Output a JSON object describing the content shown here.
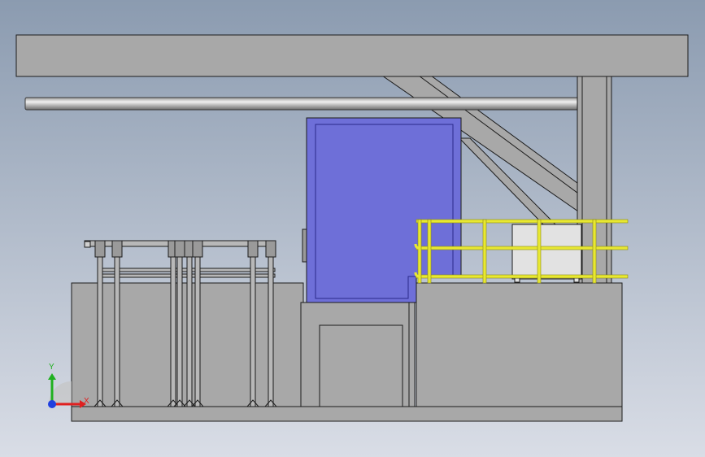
{
  "viewport": {
    "background_top": "#8b9bb0",
    "background_bottom": "#d9dde6"
  },
  "colors": {
    "structure_gray": "#a8a8a8",
    "structure_dark": "#9a9a9a",
    "outline": "#1c1c1c",
    "panel_blue": "#6e6fd8",
    "panel_blue_edge": "#3434a8",
    "rail_yellow": "#e8e832",
    "rail_yellow_edge": "#8a8a10",
    "cabinet_white": "#e2e2e2",
    "pipe_light": "#dcdcdc",
    "pipe_dark": "#7c7c7c",
    "rack_frame": "#b8b8b8"
  },
  "triad": {
    "x_label": "X",
    "y_label": "Y",
    "x_color": "#e02020",
    "y_color": "#20b020",
    "z_color": "#2040e0"
  }
}
